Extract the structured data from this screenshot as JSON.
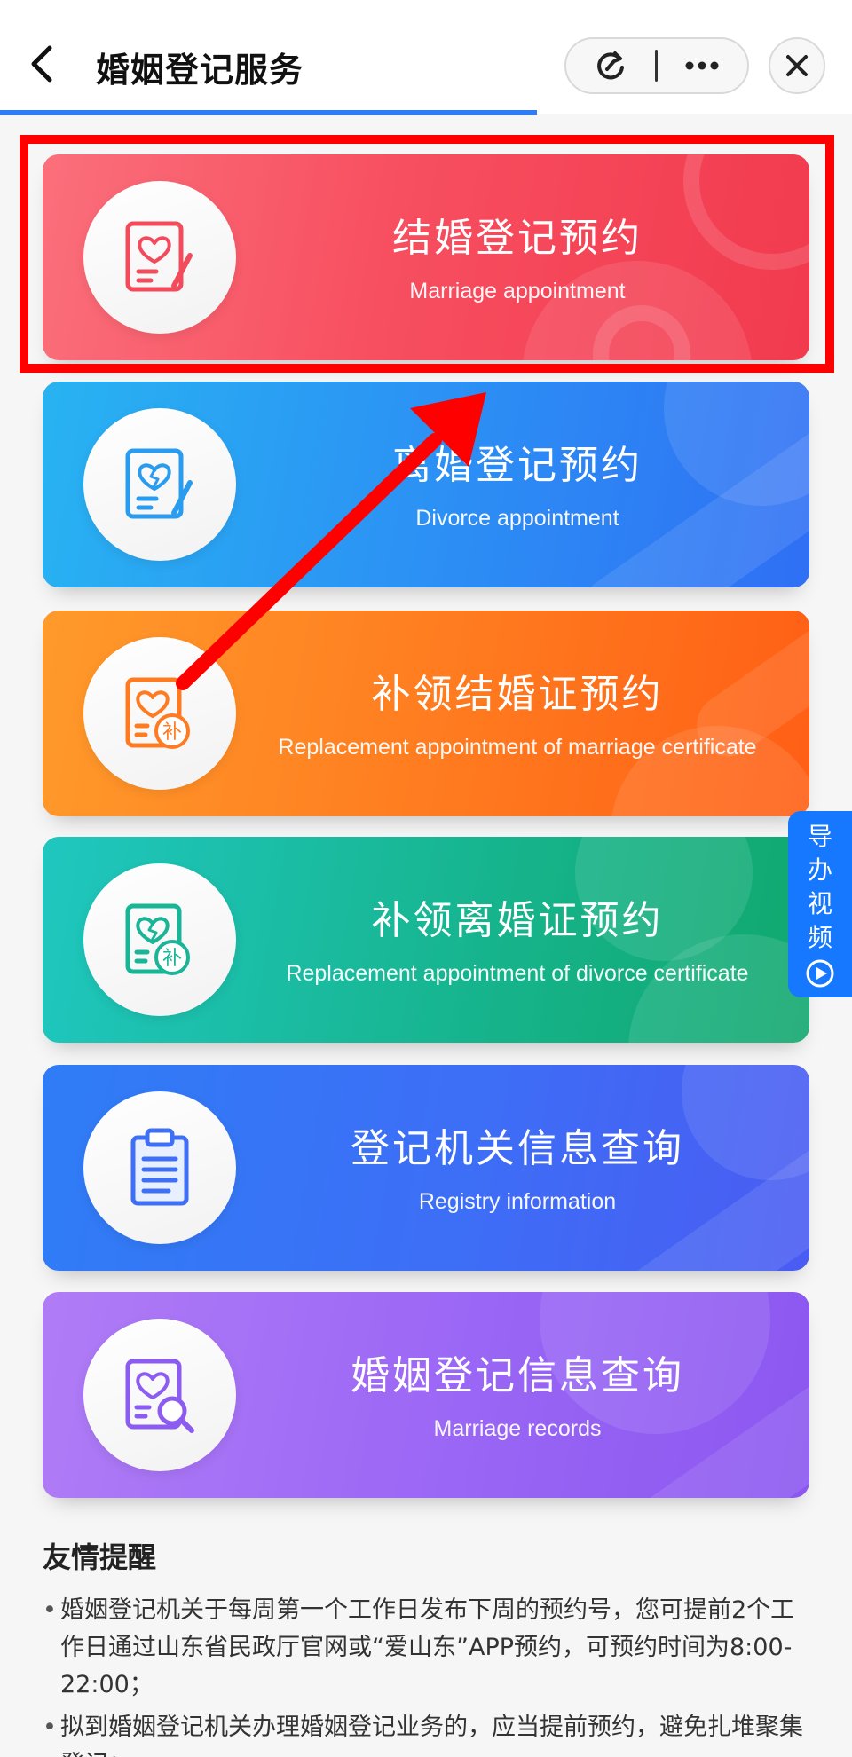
{
  "header": {
    "title": "婚姻登记服务",
    "progress_fraction": 0.63
  },
  "cards": [
    {
      "name": "marriage-appointment-card",
      "cn": "结婚登记预约",
      "en": "Marriage appointment",
      "icon": "heart-document-icon"
    },
    {
      "name": "divorce-appointment-card",
      "cn": "离婚登记预约",
      "en": "Divorce appointment",
      "icon": "broken-heart-document-icon"
    },
    {
      "name": "replacement-marriage-certificate-card",
      "cn": "补领结婚证预约",
      "en": "Replacement appointment of marriage certificate",
      "icon": "heart-certificate-replace-icon"
    },
    {
      "name": "replacement-divorce-certificate-card",
      "cn": "补领离婚证预约",
      "en": "Replacement appointment of divorce certificate",
      "icon": "broken-heart-certificate-replace-icon"
    },
    {
      "name": "registry-information-card",
      "cn": "登记机关信息查询",
      "en": "Registry information",
      "icon": "clipboard-icon"
    },
    {
      "name": "marriage-records-card",
      "cn": "婚姻登记信息查询",
      "en": "Marriage records",
      "icon": "heart-search-icon"
    }
  ],
  "icon_badge_text": "补",
  "guide_tab": {
    "label": "导办视频",
    "icon": "play-circle-icon"
  },
  "tips": {
    "title": "友情提醒",
    "items": [
      "婚姻登记机关于每周第一个工作日发布下周的预约号，您可提前2个工作日通过山东省民政厅官网或“爱山东”APP预约，可预约时间为8:00-22:00；",
      "拟到婚姻登记机关办理婚姻登记业务的，应当提前预约，避免扎堆聚集登记；"
    ]
  },
  "colors": {
    "highlight": "#ff0000",
    "arrow": "#ff0000",
    "guide_tab": "#1677ff",
    "progress": "#2e7cf6"
  }
}
